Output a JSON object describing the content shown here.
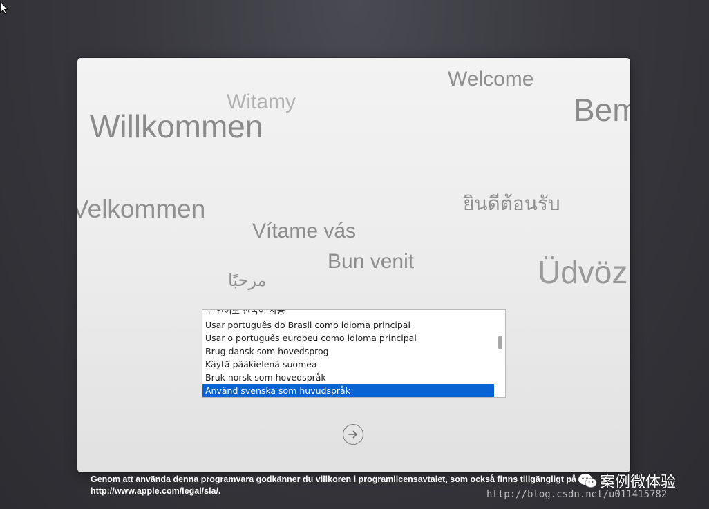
{
  "welcome_words": {
    "welcome": "Welcome",
    "witamy": "Witamy",
    "bem": "Bem",
    "willkommen": "Willkommen",
    "velkommen": "Velkommen",
    "thai": "ยินดีต้อนรับ",
    "vitame": "Vítame vás",
    "bun": "Bun venit",
    "udvoz": "Üdvöz",
    "arabic": "مرحبًا"
  },
  "language_list": {
    "items": [
      {
        "label": "주 언어로 한국어 사용",
        "selected": false
      },
      {
        "label": "Usar português do Brasil como idioma principal",
        "selected": false
      },
      {
        "label": "Usar o português europeu como idioma principal",
        "selected": false
      },
      {
        "label": "Brug dansk som hovedsprog",
        "selected": false
      },
      {
        "label": "Käytä pääkielenä suomea",
        "selected": false
      },
      {
        "label": "Bruk norsk som hovedspråk",
        "selected": false
      },
      {
        "label": "Använd svenska som huvudspråk",
        "selected": true
      }
    ]
  },
  "next_button": {
    "icon": "arrow-right-circle-icon"
  },
  "footer": {
    "line1": "Genom att använda denna programvara godkänner du villkoren i programlicensavtalet, som också finns tillgängligt på",
    "line2": "http://www.apple.com/legal/sla/."
  },
  "watermark": {
    "name": "案例微体验",
    "url": "http://blog.csdn.net/u011415782",
    "icon": "wechat-icon"
  },
  "colors": {
    "selection": "#0a63d2",
    "background": "#38383e"
  }
}
